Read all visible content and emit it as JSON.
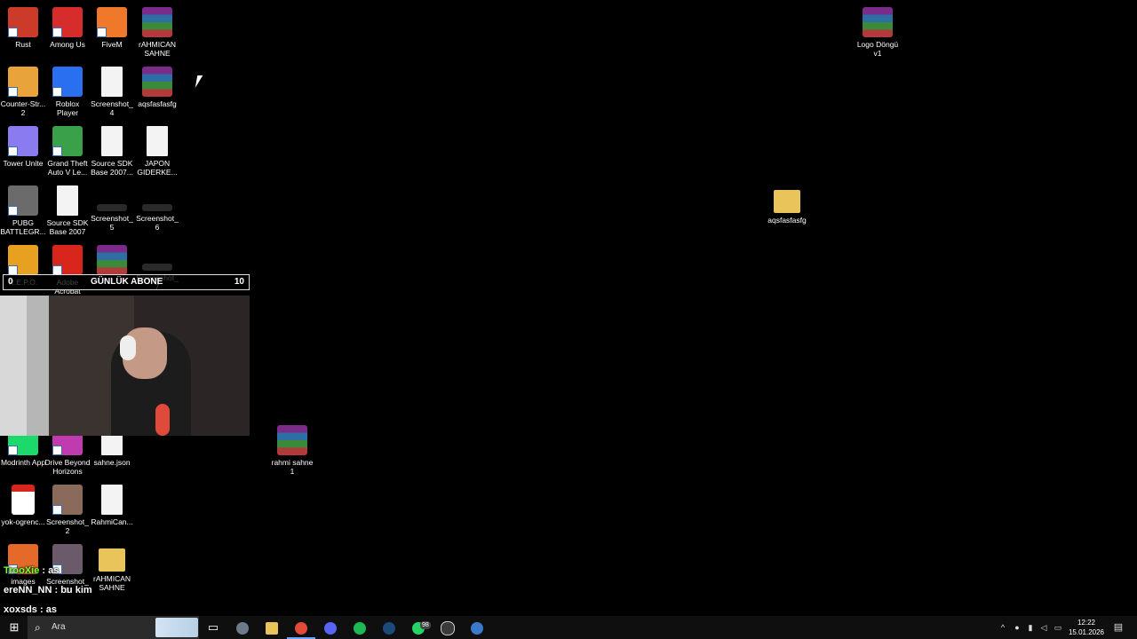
{
  "desktop": {
    "icons": [
      {
        "label": "Rust",
        "kind": "app",
        "color": "#cc3b2a"
      },
      {
        "label": "Among Us",
        "kind": "app",
        "color": "#d62c2c"
      },
      {
        "label": "FiveM",
        "kind": "app",
        "color": "#f0782a"
      },
      {
        "label": "rAHMICAN SAHNE",
        "kind": "winrar"
      },
      {
        "label": "Logo Döngü v1",
        "kind": "winrar"
      },
      {
        "label": "Counter-Str... 2",
        "kind": "app",
        "color": "#e8a43a"
      },
      {
        "label": "Roblox Player",
        "kind": "app",
        "color": "#2a6ff0"
      },
      {
        "label": "Screenshot_4",
        "kind": "file"
      },
      {
        "label": "aqsfasfasfg",
        "kind": "winrar"
      },
      {
        "label": "Tower Unite",
        "kind": "app",
        "color": "#8a7cf0"
      },
      {
        "label": "Grand Theft Auto V Le...",
        "kind": "app",
        "color": "#3aa04a"
      },
      {
        "label": "Source SDK Base 2007...",
        "kind": "file"
      },
      {
        "label": "JAPON GIDERKE...",
        "kind": "file"
      },
      {
        "label": "PUBG BATTLEGR...",
        "kind": "app",
        "color": "#6b6b6b"
      },
      {
        "label": "Source SDK Base 2007",
        "kind": "file"
      },
      {
        "label": "Screenshot_5",
        "kind": "shot"
      },
      {
        "label": "Screenshot_6",
        "kind": "shot"
      },
      {
        "label": "aqsfasfasfg",
        "kind": "folder"
      },
      {
        "label": "R.E.P.O.",
        "kind": "app",
        "color": "#e8a020"
      },
      {
        "label": "Adobe Acrobat",
        "kind": "app",
        "color": "#d8261c"
      },
      {
        "label": "",
        "kind": "winrar"
      },
      {
        "label": "Screenshot_7",
        "kind": "shot"
      },
      {
        "label": "Modrinth App",
        "kind": "app",
        "color": "#1bd96a"
      },
      {
        "label": "Drive Beyond Horizons",
        "kind": "app",
        "color": "#c03ab0"
      },
      {
        "label": "sahne.json",
        "kind": "file"
      },
      {
        "label": "rahmi sahne 1",
        "kind": "winrar"
      },
      {
        "label": "yok-ogrenc...",
        "kind": "pdf"
      },
      {
        "label": "Screenshot_2",
        "kind": "app",
        "color": "#8a6a5a"
      },
      {
        "label": "RahmiCan...",
        "kind": "file"
      },
      {
        "label": "images",
        "kind": "app",
        "color": "#e46a2a"
      },
      {
        "label": "Screenshot_3",
        "kind": "app",
        "color": "#6a5a6a"
      },
      {
        "label": "rAHMICAN SAHNE",
        "kind": "folder"
      }
    ]
  },
  "overlay": {
    "sub_bar": {
      "left": "0",
      "title": "GÜNLÜK ABONE",
      "right": "10"
    },
    "chat": [
      {
        "user": "TrooXie",
        "message": "as",
        "user_color": "#7cff3a"
      },
      {
        "user": "ereNN_NN",
        "message": "bu kim",
        "user_color": "#ffffff"
      },
      {
        "user": "xoxsds",
        "message": "as",
        "user_color": "#ffffff"
      }
    ]
  },
  "taskbar": {
    "search_placeholder": "Ara",
    "whatsapp_badge": "98",
    "clock_time": "12:22",
    "clock_date": "15.01.2026"
  }
}
